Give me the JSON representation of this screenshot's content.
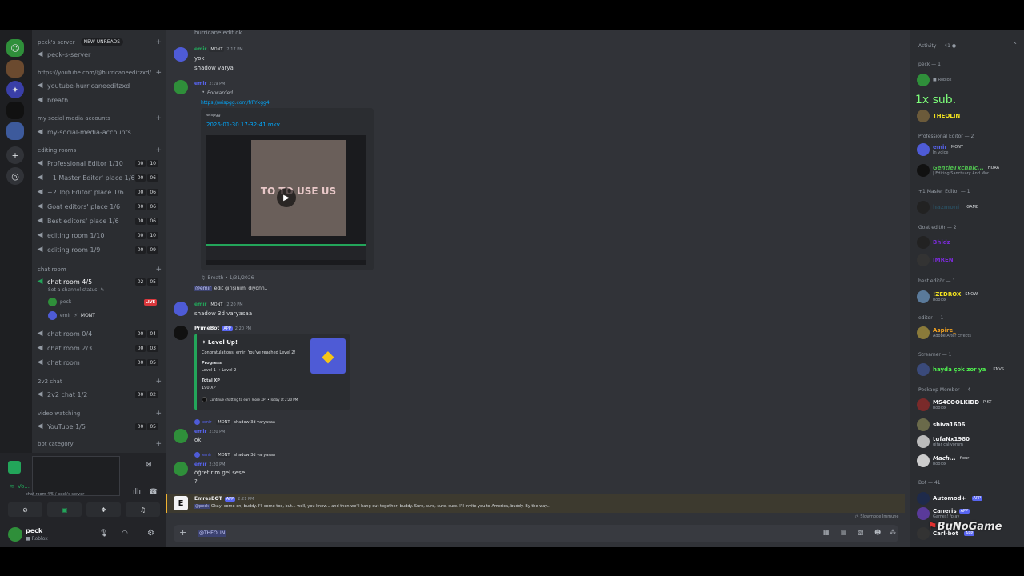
{
  "server": {
    "name": "peck's server",
    "new_unreads": "NEW UNREADS",
    "ch_peck": "peck-s-server",
    "cat_youtube": "https://youtube.com/@hurricaneeditzxd/",
    "ch_youtube": "youtube-hurricaneeditzxd",
    "ch_breath": "breath",
    "cat_social": "my social media accounts",
    "ch_social": "my-social-media-accounts",
    "cat_editing": "editing rooms",
    "editing": [
      {
        "label": "Professional Editor 1/10",
        "a": "00",
        "b": "10"
      },
      {
        "label": "+1 Master Editor' place 1/6",
        "a": "00",
        "b": "06"
      },
      {
        "label": "+2 Top Editor' place 1/6",
        "a": "00",
        "b": "06"
      },
      {
        "label": "Goat editors' place 1/6",
        "a": "00",
        "b": "06"
      },
      {
        "label": "Best editors' place 1/6",
        "a": "00",
        "b": "06"
      },
      {
        "label": "editing room 1/10",
        "a": "00",
        "b": "10"
      },
      {
        "label": "editing room 1/9",
        "a": "00",
        "b": "09"
      }
    ],
    "cat_chat": "chat room",
    "chat_active": {
      "label": "chat room 4/5",
      "a": "02",
      "b": "05"
    },
    "channel_status": "Set a channel status",
    "voice_user1": "peck",
    "live": "LIVE",
    "voice_user2": "emir",
    "voice_user2_tag": "MONT",
    "chat_rooms": [
      {
        "label": "chat room 0/4",
        "a": "00",
        "b": "04"
      },
      {
        "label": "chat room 2/3",
        "a": "00",
        "b": "03"
      },
      {
        "label": "chat room",
        "a": "00",
        "b": "05"
      }
    ],
    "cat_2v2": "2v2 chat",
    "ch_2v2": {
      "label": "2v2 chat 1/2",
      "a": "00",
      "b": "02"
    },
    "cat_video": "video watching",
    "ch_video": {
      "label": "YouTube 1/5",
      "a": "00",
      "b": "05"
    },
    "cat_bot": "bot category"
  },
  "voice_panel": {
    "status": "Vo...",
    "sub": "chat room 4/5 / peck's server"
  },
  "user_panel": {
    "name": "peck",
    "status": "Roblox"
  },
  "chat": {
    "top_text": "hurricane edit ok ...",
    "m1": {
      "user": "emir",
      "tag": "MONT",
      "time": "2:17 PM",
      "line1": "yok",
      "line2": "shadow varya"
    },
    "m2": {
      "user": "emir",
      "time": "2:19 PM",
      "forwarded": "Forwarded",
      "link": "https://wispgg.com/f/PYxgg4",
      "embed_site": "wispgg",
      "embed_title": "2026-01-30 17-32-41.mkv",
      "video_overlay": "TO TO USE US",
      "origin": "Breath • 1/31/2026"
    },
    "m2b": {
      "mention": "@emir",
      "text": "edit girişinimi diyonn.."
    },
    "m3": {
      "user": "emir",
      "tag": "MONT",
      "time": "2:20 PM",
      "text": "shadow 3d varyasaa"
    },
    "m4": {
      "user": "PrimeBot",
      "app": "APP",
      "time": "2:20 PM",
      "embed_title": "Level Up!",
      "congrats": "Congratulations, emir! You've reached Level 2!",
      "progress_label": "Progress",
      "progress": "Level 1 → Level 2",
      "xp_label": "Total XP",
      "xp": "190 XP",
      "footer": "Continue chatting to earn more XP! • Today at 2:20 PM"
    },
    "m5": {
      "reply_user": "emir",
      "reply_tag": "MONT",
      "reply_text": "shadow 3d varyasaa",
      "user": "emir",
      "time": "2:20 PM",
      "text": "ok"
    },
    "m6": {
      "reply_user": "emir",
      "reply_tag": "MONT",
      "reply_text": "shadow 3d varyasaa",
      "user": "emir",
      "time": "2:20 PM",
      "line1": "öğretirim gel sese",
      "line2": "?"
    },
    "m7": {
      "user": "EmresBOT",
      "app": "APP",
      "time": "2:21 PM",
      "mention": "@peck",
      "text": "Okay, come on, buddy. I'll come too, but... well, you know... and then we'll hang out together, buddy. Sure, sure, sure, sure. I'll invite you to America, buddy. By the way..."
    },
    "slowmode": "Slowmode Immune",
    "composer_value": "@THEOLIN"
  },
  "members": {
    "activity": "Activity — 41",
    "cat_peck": "peck — 1",
    "peck_status": "Roblox",
    "overlay": "1x sub.",
    "theolin": "THEOLIN",
    "cat_pro": "Professional Editor — 2",
    "pro1": "emir",
    "pro1_tag": "MONT",
    "pro1_status": "In voice",
    "pro2": "GentleTxchnic...",
    "pro2_tag": "HURA",
    "pro2_status": "| Editing Sanctuary And Mor...",
    "cat_master": "+1 Master Editor — 1",
    "master1": "hazmoni",
    "master1_tag": "GAMB",
    "cat_goat": "Goat editör — 2",
    "goat1": "Bhidz",
    "goat2": "IMREN",
    "cat_best": "best editör — 1",
    "best1": "!ZEDROX",
    "best1_tag": "SNOW",
    "best1_status": "Roblox",
    "cat_editor": "editor — 1",
    "editor1": "Aspire_",
    "editor1_status": "Adobe After Effects",
    "cat_streamer": "Streamer — 1",
    "streamer1": "hayda çok zor ya",
    "streamer1_tag": "KNVS",
    "cat_peckaep": "Peckaep Member — 4",
    "pm1": "MS4COOLKIDD",
    "pm1_tag": "PIKT",
    "pm1_status": "Roblox",
    "pm2": "shiva1606",
    "pm3": "tufaNx1980",
    "pm3_status": "gitar çalıyorum",
    "pm4": "Mach...",
    "pm4_tag": "flour",
    "pm4_status": "Roblox",
    "cat_bot": "Bot — 41",
    "bot1": "Automod+",
    "bot1_tag": "APP",
    "bot2": "Caneris",
    "bot2_tag": "APP",
    "bot2_status": "Games! /play",
    "bot3": "Carl-bot",
    "bot3_tag": "APP",
    "watermark": "BuNoGame"
  },
  "colors": {
    "accent": "#5865f2",
    "green": "#23a55a",
    "bg": "#313338"
  }
}
